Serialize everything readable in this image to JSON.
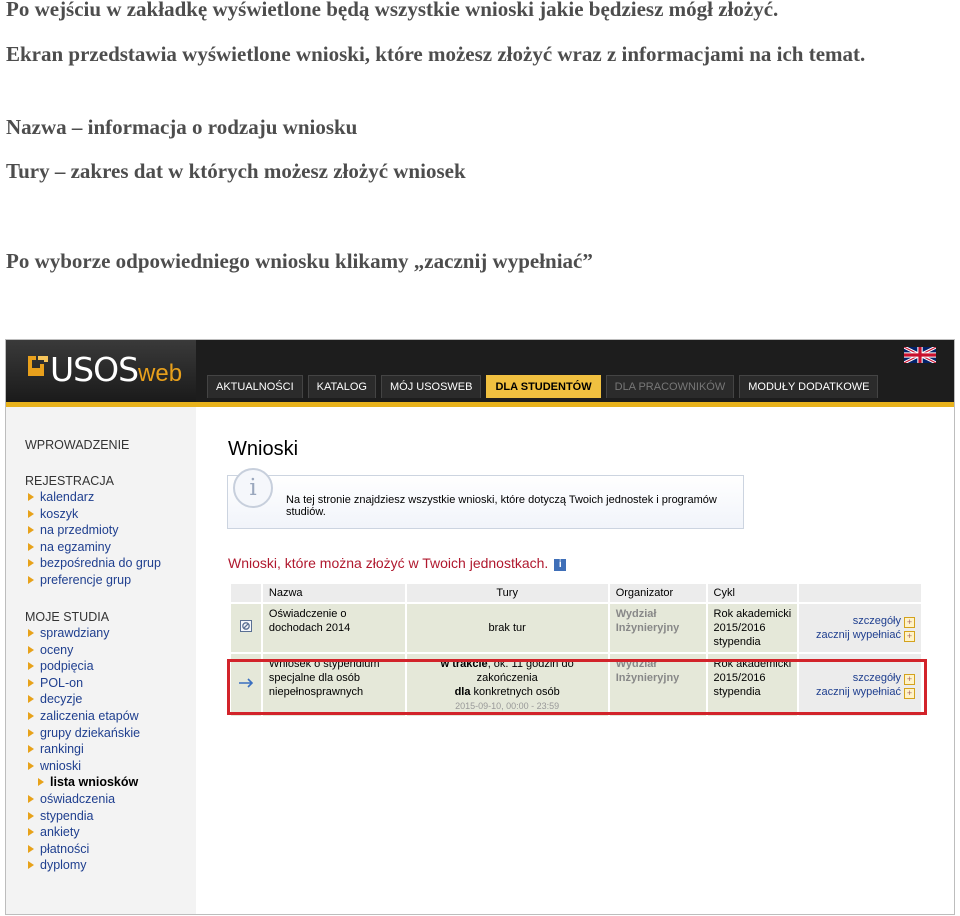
{
  "doc": {
    "line1": "Po wejściu w zakładkę wyświetlone będą wszystkie wnioski jakie będziesz mógł złożyć.",
    "line2": "Ekran przedstawia wyświetlone wnioski, które możesz złożyć wraz z informacjami na ich temat.",
    "line3": "Nazwa – informacja o rodzaju wniosku",
    "line4": "Tury – zakres dat w których możesz złożyć wniosek",
    "line5": "Po wyborze odpowiedniego wniosku klikamy „zacznij wypełniać”"
  },
  "app": {
    "logo": "USOS",
    "logo_suffix": "web",
    "nav": [
      "AKTUALNOŚCI",
      "KATALOG",
      "MÓJ USOSWEB",
      "DLA STUDENTÓW",
      "DLA PRACOWNIKÓW",
      "MODUŁY DODATKOWE"
    ],
    "nav_active_index": 3
  },
  "sidebar": {
    "intro": "WPROWADZENIE",
    "rejestracja_head": "REJESTRACJA",
    "rejestracja": [
      "kalendarz",
      "koszyk",
      "na przedmioty",
      "na egzaminy",
      "bezpośrednia do grup",
      "preferencje grup"
    ],
    "studia_head": "MOJE STUDIA",
    "studia": [
      "sprawdziany",
      "oceny",
      "podpięcia",
      "POL-on",
      "decyzje",
      "zaliczenia etapów",
      "grupy dziekańskie",
      "rankingi",
      "wnioski",
      "lista wniosków",
      "oświadczenia",
      "stypendia",
      "ankiety",
      "płatności",
      "dyplomy"
    ]
  },
  "main": {
    "title": "Wnioski",
    "info": "Na tej stronie znajdziesz wszystkie wnioski, które dotyczą Twoich jednostek i programów studiów.",
    "section": "Wnioski, które można złożyć w Twoich jednostkach.",
    "headers": [
      "Nazwa",
      "Tury",
      "Organizator",
      "Cykl"
    ],
    "rows": [
      {
        "name": "Oświadczenie o dochodach 2014",
        "tury": "brak tur",
        "org": "Wydział Inżynieryjny",
        "cykl": "Rok akademicki 2015/2016 stypendia",
        "link1": "szczegóły",
        "link2": "zacznij wypełniać"
      },
      {
        "name": "Wniosek o stypendium specjalne dla osób niepełnosprawnych",
        "tury_status": "w trakcie",
        "tury_mid": ", ok. 11 godzin do zakończenia",
        "tury_dla": "dla",
        "tury_rest": " konkretnych osób",
        "tury_dates": "2015-09-10, 00:00 - 23:59",
        "org": "Wydział Inżynieryjny",
        "cykl": "Rok akademicki 2015/2016 stypendia",
        "link1": "szczegóły",
        "link2": "zacznij wypełniać"
      }
    ]
  },
  "colors": {
    "accent": "#e8b21c",
    "section_title": "#b0182e",
    "highlight": "#d2232a",
    "link": "#1f3f8f"
  }
}
